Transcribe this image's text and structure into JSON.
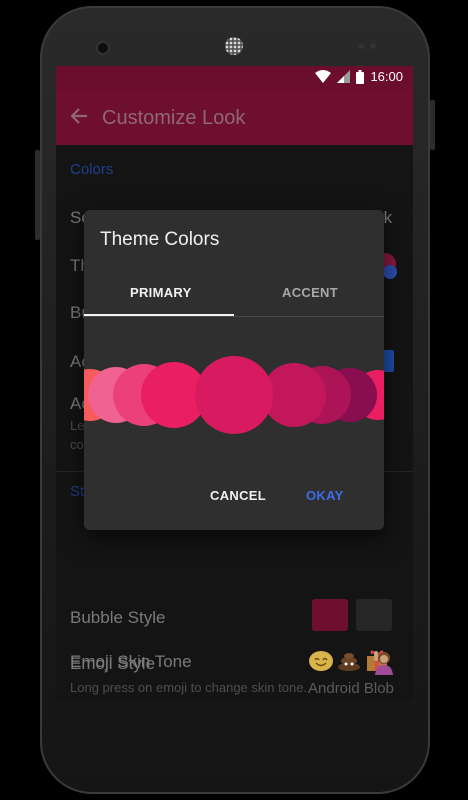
{
  "status_bar": {
    "time": "16:00",
    "icons": [
      "wifi-icon",
      "signal-icon",
      "battery-icon"
    ]
  },
  "toolbar": {
    "title": "Customize Look",
    "back_icon": "arrow-left-icon"
  },
  "settings": {
    "colors_header": "Colors",
    "item_fragments": [
      "Sc",
      "Th",
      "Bu",
      "Ac",
      "Ac",
      "Le",
      "co"
    ],
    "trailing_fragment": "rk",
    "style_header_fragment": "St",
    "bubble_style": "Bubble Style",
    "emoji_style": "Emoji Style",
    "emoji_style_value": "Android Blob",
    "emoji_skin_tone": "Emoji Skin Tone",
    "emoji_skin_tone_desc": "Long press on emoji to change skin tone."
  },
  "dialog": {
    "title": "Theme Colors",
    "tabs": [
      {
        "label": "PRIMARY",
        "selected": true
      },
      {
        "label": "ACCENT",
        "selected": false
      }
    ],
    "swatch_colors": [
      "#f75b5b",
      "#f06292",
      "#ec407a",
      "#e91e63",
      "#d81b60",
      "#c2185b",
      "#ad1457",
      "#880e4f",
      "#e91e63"
    ],
    "cancel_label": "CANCEL",
    "ok_label": "OKAY"
  },
  "colors": {
    "primary_dark": "#6b0d2d",
    "primary": "#6e0f30",
    "accent_blue": "#3b6ee8",
    "dialog_bg": "#2f2f2f"
  }
}
